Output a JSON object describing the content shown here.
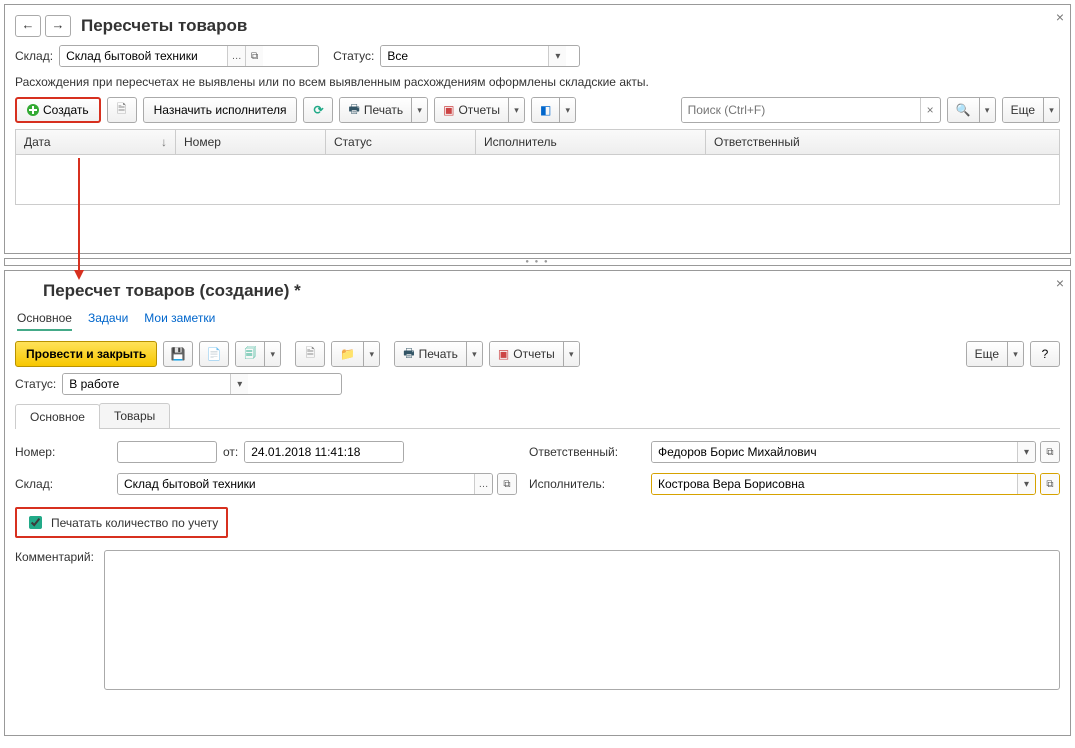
{
  "top": {
    "title": "Пересчеты товаров",
    "warehouse_label": "Склад:",
    "warehouse_value": "Склад бытовой техники",
    "status_label": "Статус:",
    "status_value": "Все",
    "info": "Расхождения при пересчетах не выявлены или по всем выявленным расхождениям оформлены складские акты.",
    "create_label": "Создать",
    "assign_label": "Назначить исполнителя",
    "print_label": "Печать",
    "reports_label": "Отчеты",
    "search_placeholder": "Поиск (Ctrl+F)",
    "more_label": "Еще",
    "columns": {
      "date": "Дата",
      "number": "Номер",
      "status": "Статус",
      "executor": "Исполнитель",
      "responsible": "Ответственный"
    }
  },
  "bottom": {
    "title": "Пересчет товаров (создание) *",
    "tab_main": "Основное",
    "tab_tasks": "Задачи",
    "tab_notes": "Мои заметки",
    "post_close": "Провести и закрыть",
    "print_label": "Печать",
    "reports_label": "Отчеты",
    "more_label": "Еще",
    "status_label": "Статус:",
    "status_value": "В работе",
    "tab_osn": "Основное",
    "tab_goods": "Товары",
    "number_label": "Номер:",
    "from_label": "от:",
    "date_value": "24.01.2018 11:41:18",
    "responsible_label": "Ответственный:",
    "responsible_value": "Федоров Борис Михайлович",
    "warehouse_label": "Склад:",
    "warehouse_value": "Склад бытовой техники",
    "executor_label": "Исполнитель:",
    "executor_value": "Кострова Вера Борисовна",
    "print_qty_label": "Печатать количество по учету",
    "comment_label": "Комментарий:"
  }
}
